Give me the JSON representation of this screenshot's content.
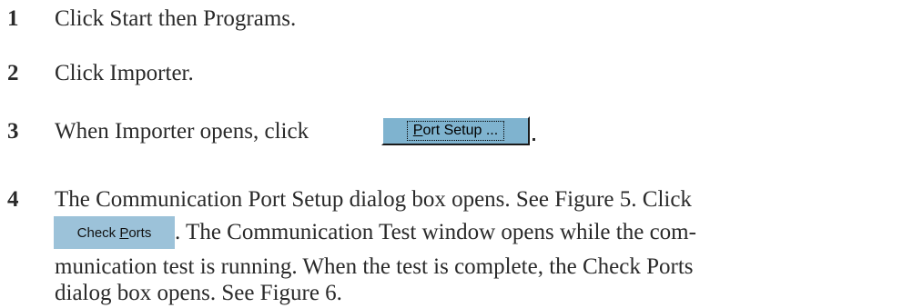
{
  "steps": [
    {
      "number": "1",
      "text": "Click Start then Programs."
    },
    {
      "number": "2",
      "text": "Click Importer."
    },
    {
      "number": "3",
      "text_before": "When Importer opens, click",
      "button": {
        "mnemonic": "P",
        "rest": "ort Setup ..."
      },
      "text_after": "."
    },
    {
      "number": "4",
      "line1": "The Communication Port Setup dialog box opens. See Figure 5. Click",
      "button": {
        "before": "Check ",
        "mnemonic": "P",
        "rest": "orts"
      },
      "line2_after": ". The Communication Test window opens while the com-",
      "line3": "munication test is running. When the test is complete, the Check Ports",
      "line4": "dialog box opens. See Figure 6."
    }
  ]
}
